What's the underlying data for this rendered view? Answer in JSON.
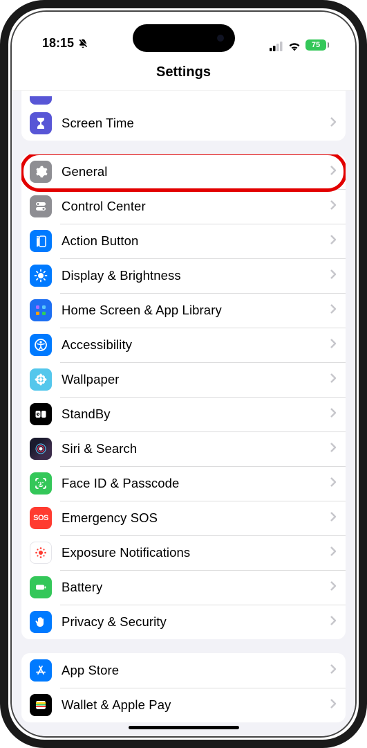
{
  "status": {
    "time": "18:15",
    "battery_pct": "75"
  },
  "header": {
    "title": "Settings"
  },
  "group1": {
    "screen_time": "Screen Time"
  },
  "group2": {
    "general": "General",
    "control_center": "Control Center",
    "action_button": "Action Button",
    "display_brightness": "Display & Brightness",
    "home_screen": "Home Screen & App Library",
    "accessibility": "Accessibility",
    "wallpaper": "Wallpaper",
    "standby": "StandBy",
    "siri_search": "Siri & Search",
    "face_id": "Face ID & Passcode",
    "emergency_sos": "Emergency SOS",
    "sos_text": "SOS",
    "exposure": "Exposure Notifications",
    "battery": "Battery",
    "privacy": "Privacy & Security"
  },
  "group3": {
    "app_store": "App Store",
    "wallet": "Wallet & Apple Pay"
  }
}
